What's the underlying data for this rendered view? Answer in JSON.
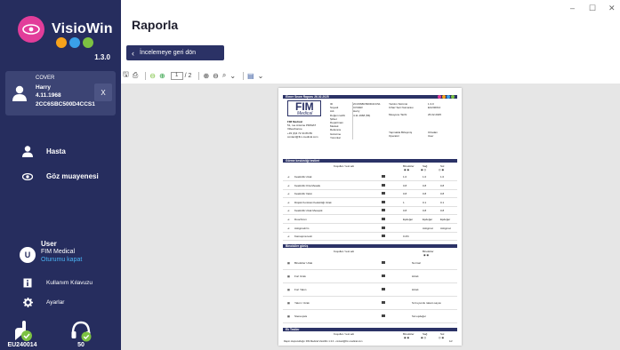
{
  "app": {
    "name": "VisioWin",
    "version": "1.3.0",
    "brand_colors": {
      "sidebar": "#262d5e",
      "accent_pink": "#e23d9a",
      "dot_orange": "#f7a21b",
      "dot_blue": "#3aa0e8",
      "dot_green": "#7cc242",
      "link": "#4ab3f4"
    }
  },
  "patient": {
    "cover": "COVER",
    "name": "Harry",
    "birth_date": "4.11.1968",
    "id": "2CC6SBC500D4CCS1",
    "close_label": "X"
  },
  "nav": {
    "items": [
      {
        "label": "Hasta",
        "icon": "person-icon"
      },
      {
        "label": "Göz muayenesi",
        "icon": "eye-icon"
      }
    ]
  },
  "user": {
    "initial": "U",
    "name": "User",
    "org": "FIM Medical",
    "logout": "Oturumu kapat"
  },
  "menu": {
    "manual": "Kullanım Kılavuzu",
    "settings": "Ayarlar"
  },
  "stats": {
    "device": "EU240014",
    "count": "50"
  },
  "main": {
    "title": "Raporla",
    "back_button": "İncelemeye geri dön"
  },
  "window_controls": {
    "minimize": "–",
    "maximize": "☐",
    "close": "✕"
  },
  "pdf_toolbar": {
    "page_current": "1",
    "page_total": "/ 2"
  },
  "report": {
    "header_band": "Elmer Snow Raporu 26.02.2025",
    "logo_text": "FIM",
    "logo_sub": "Medical",
    "company_lines": [
      "FIM Medical",
      "51, rue Antoine PRIMAT",
      "Villeurbanne",
      "+33 (0)4 72 34 89 89",
      "contact@fim-medical.com"
    ],
    "fields_left": [
      "ID",
      "Soyadı",
      "Adı",
      "Doğum tarihi",
      "Şirket",
      "Departman",
      "Meslek",
      "Referans",
      "Gözetme",
      "Yorumlar"
    ],
    "fields_left_values": [
      "2CC6SBC500D4CCS1",
      "COVER",
      "Harry",
      "4.11.1968 (56)",
      "",
      "",
      "",
      "",
      "",
      ""
    ],
    "fields_right": [
      "Yazılım Sürümü",
      "Cihaz Seri Numarası",
      "Muayene Tarihi"
    ],
    "fields_right_values": [
      "1.3.0",
      "EU240014",
      "26.02.2025"
    ],
    "fields_right2": [
      "Yapmakla Birleşmiş",
      "Operatör"
    ],
    "fields_right2_values": [
      "Ortadan",
      "User"
    ],
    "section1": "Görme keskinliği testleri",
    "section2": "Binoküler görüş",
    "section3": "Ek Testler",
    "col_headers": [
      "Koşullar / test adı",
      "Binoküler",
      "Sağ",
      "Sol"
    ],
    "rows1": [
      {
        "label": "Keskinlik Uzak",
        "b": "1.0",
        "r": "1.0",
        "l": "1.0"
      },
      {
        "label": "Keskinlik Orta Mesafe",
        "b": "0.8",
        "r": "0.8",
        "l": "0.8"
      },
      {
        "label": "Keskinlik Yakın",
        "b": "0.8",
        "r": "0.8",
        "l": "0.8"
      },
      {
        "label": "Düşük Kontrast Keskinliği Uzak",
        "b": "1",
        "r": "0.1",
        "l": "0.1"
      },
      {
        "label": "Keskinlik Uzak Mesopik",
        "b": "0.8",
        "r": "0.8",
        "l": "0.8"
      },
      {
        "label": "Duochrom",
        "b": "Eşdeğer",
        "r": "Eşdeğer",
        "l": "Eşdeğer"
      },
      {
        "label": "Astigmatizm",
        "b": "",
        "r": "Astigmat",
        "l": "Astigmat"
      },
      {
        "label": "Kamaşma testi",
        "b": "0.2%",
        "r": "",
        "l": ""
      }
    ],
    "rows2": [
      {
        "label": "Binoküler Uzak",
        "v": "Normal"
      },
      {
        "label": "Fori Uzak",
        "v": "Hizalı"
      },
      {
        "label": "Fori Yakın",
        "v": "Hizalı"
      },
      {
        "label": "Yakın / Uzak",
        "v": "Sırt uyumlu rakam sayısı"
      },
      {
        "label": "Stereopsis",
        "v": "Sol eşdeğer"
      }
    ],
    "footer": "Rapor oluşturulduğu: FIM Medical VisioWin 1.3.0 - contact@fim-medical.com",
    "page_num": "1/2"
  }
}
